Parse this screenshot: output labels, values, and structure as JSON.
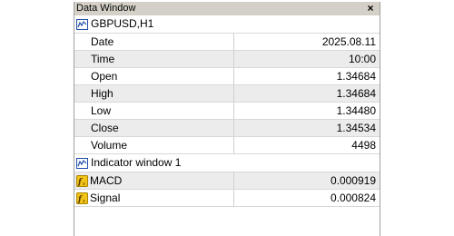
{
  "window": {
    "title": "Data Window",
    "close_glyph": "×"
  },
  "symbol_group": {
    "label": "GBPUSD,H1",
    "icon": "chart-line-icon",
    "rows": [
      {
        "label": "Date",
        "value": "2025.08.11"
      },
      {
        "label": "Time",
        "value": "10:00"
      },
      {
        "label": "Open",
        "value": "1.34684"
      },
      {
        "label": "High",
        "value": "1.34684"
      },
      {
        "label": "Low",
        "value": "1.34480"
      },
      {
        "label": "Close",
        "value": "1.34534"
      },
      {
        "label": "Volume",
        "value": "4498"
      }
    ]
  },
  "indicator_group": {
    "label": "Indicator window 1",
    "icon": "chart-line-icon",
    "rows": [
      {
        "label": "MACD",
        "value": "0.000919",
        "icon": "indicator-fx-icon"
      },
      {
        "label": "Signal",
        "value": "0.000824",
        "icon": "indicator-fx-icon"
      }
    ]
  },
  "colors": {
    "titlebar": "#d4d0c8",
    "alt_row": "#ececec",
    "icon_blue": "#1f4fa8",
    "fx_yellow": "#f2c417"
  }
}
